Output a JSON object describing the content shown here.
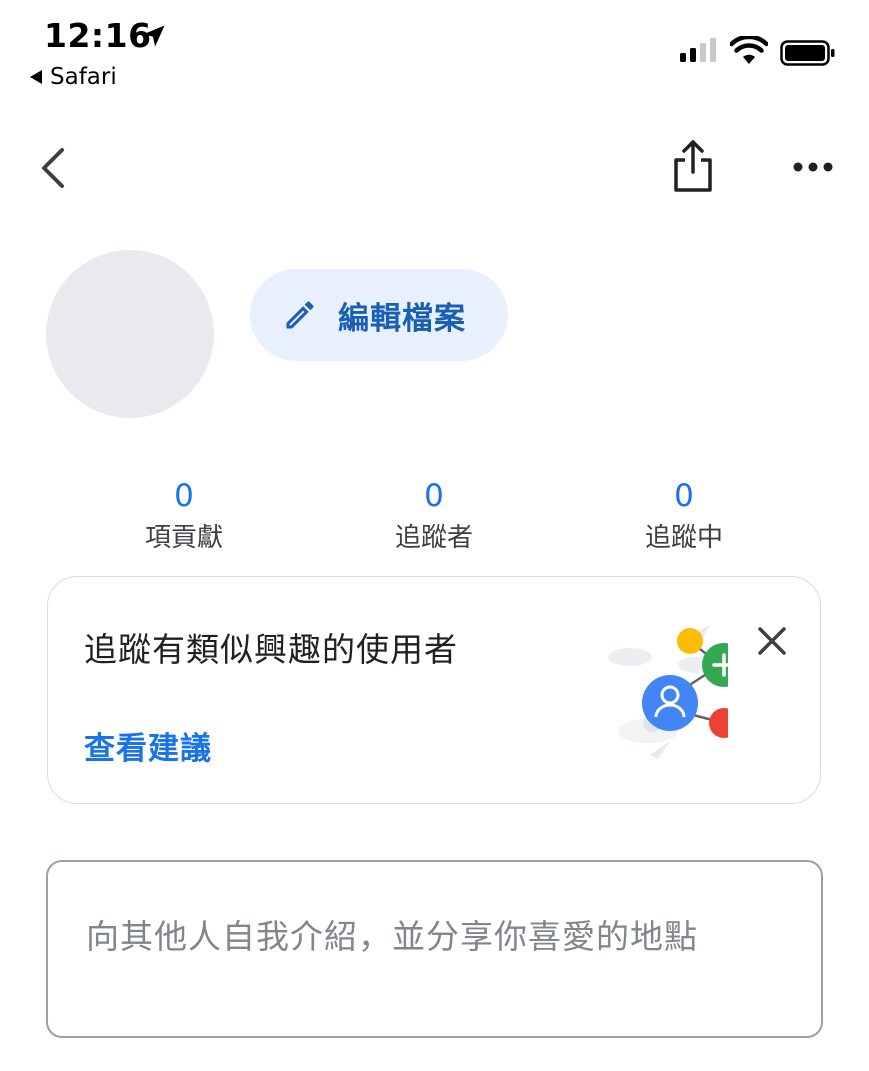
{
  "status_bar": {
    "time": "12:16",
    "back_app": "Safari"
  },
  "profile": {
    "edit_label": "編輯檔案"
  },
  "stats": [
    {
      "value": "0",
      "label": "項貢獻"
    },
    {
      "value": "0",
      "label": "追蹤者"
    },
    {
      "value": "0",
      "label": "追蹤中"
    }
  ],
  "suggestion_card": {
    "title": "追蹤有類似興趣的使用者",
    "link": "查看建議"
  },
  "bio": {
    "placeholder": "向其他人自我介紹，並分享你喜愛的地點"
  },
  "icons": {
    "location": "location-arrow-icon",
    "signal": "cellular-signal-icon",
    "wifi": "wifi-icon",
    "battery": "battery-icon",
    "back": "chevron-left-icon",
    "share": "share-icon",
    "more": "more-horizontal-icon",
    "edit": "pencil-icon",
    "close": "close-icon"
  },
  "colors": {
    "accent": "#1a73e8",
    "edit_button_bg": "#e8f0fe",
    "avatar_bg": "#e8eaed"
  }
}
